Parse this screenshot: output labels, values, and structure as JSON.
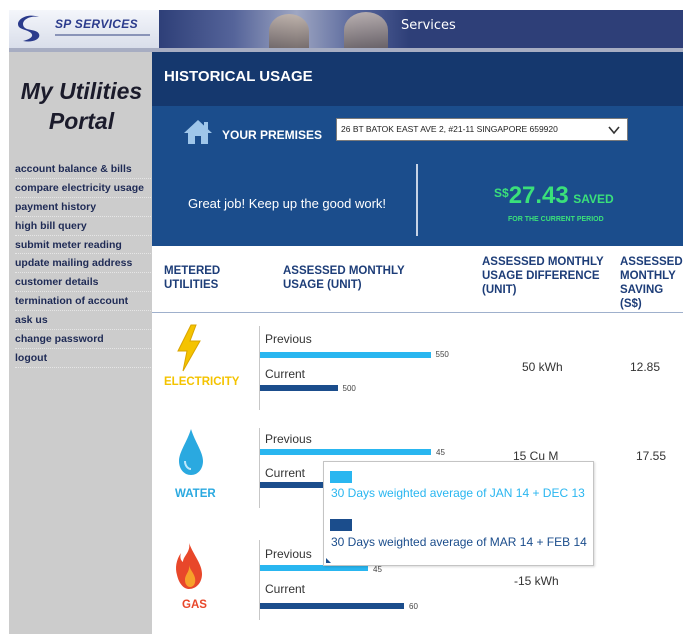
{
  "banner": {
    "logo_text": "SP SERVICES",
    "title": "Services"
  },
  "sidebar": {
    "portal_title_line1": "My Utilities",
    "portal_title_line2": "Portal",
    "items": [
      {
        "label": "account balance & bills"
      },
      {
        "label": "compare electricity usage"
      },
      {
        "label": "payment history"
      },
      {
        "label": "high bill query"
      },
      {
        "label": "submit meter reading"
      },
      {
        "label": "update mailing address"
      },
      {
        "label": "customer details"
      },
      {
        "label": "termination of account"
      },
      {
        "label": "ask us"
      },
      {
        "label": "change password"
      },
      {
        "label": "logout"
      }
    ]
  },
  "main": {
    "title": "HISTORICAL USAGE",
    "premises_label": "YOUR PREMISES",
    "premises_value": "26 BT BATOK EAST AVE 2, #21-11 SINGAPORE 659920",
    "message": "Great job! Keep up the good work!",
    "saved_currency": "S$",
    "saved_amount": "27.43",
    "saved_word": "SAVED",
    "saved_period": "FOR THE CURRENT PERIOD"
  },
  "columns": {
    "c1_l1": "METERED",
    "c1_l2": "UTILITIES",
    "c2_l1": "ASSESSED MONTHLY",
    "c2_l2": "USAGE (UNIT)",
    "c3_l1": "ASSESSED MONTHLY",
    "c3_l2": "USAGE DIFFERENCE",
    "c3_l3": "(UNIT)",
    "c4_l1": "ASSESSED",
    "c4_l2": "MONTHLY",
    "c4_l3": "SAVING (S$)"
  },
  "bar_labels": {
    "previous": "Previous",
    "current": "Current"
  },
  "utilities": {
    "electricity": {
      "name": "ELECTRICITY",
      "previous": 550,
      "current": 500,
      "diff": "50 kWh",
      "saving": "12.85"
    },
    "water": {
      "name": "WATER",
      "previous": 45,
      "current": "",
      "diff": "15 Cu M",
      "saving": "17.55"
    },
    "gas": {
      "name": "GAS",
      "previous": 45,
      "current": 60,
      "diff": "-15 kWh",
      "saving": ""
    }
  },
  "tooltip": {
    "previous_desc": "30 Days weighted average of JAN 14 + DEC 13",
    "current_desc": "30 Days weighted average of MAR 14 + FEB 14"
  },
  "colors": {
    "header_navy": "#15386e",
    "panel_blue": "#1b4d8c",
    "previous_bar": "#29b6f0",
    "current_bar": "#1b4d8c",
    "saved_green": "#3ae07a",
    "electricity": "#f4c300",
    "water": "#2aa9e0",
    "gas": "#e8472a"
  }
}
